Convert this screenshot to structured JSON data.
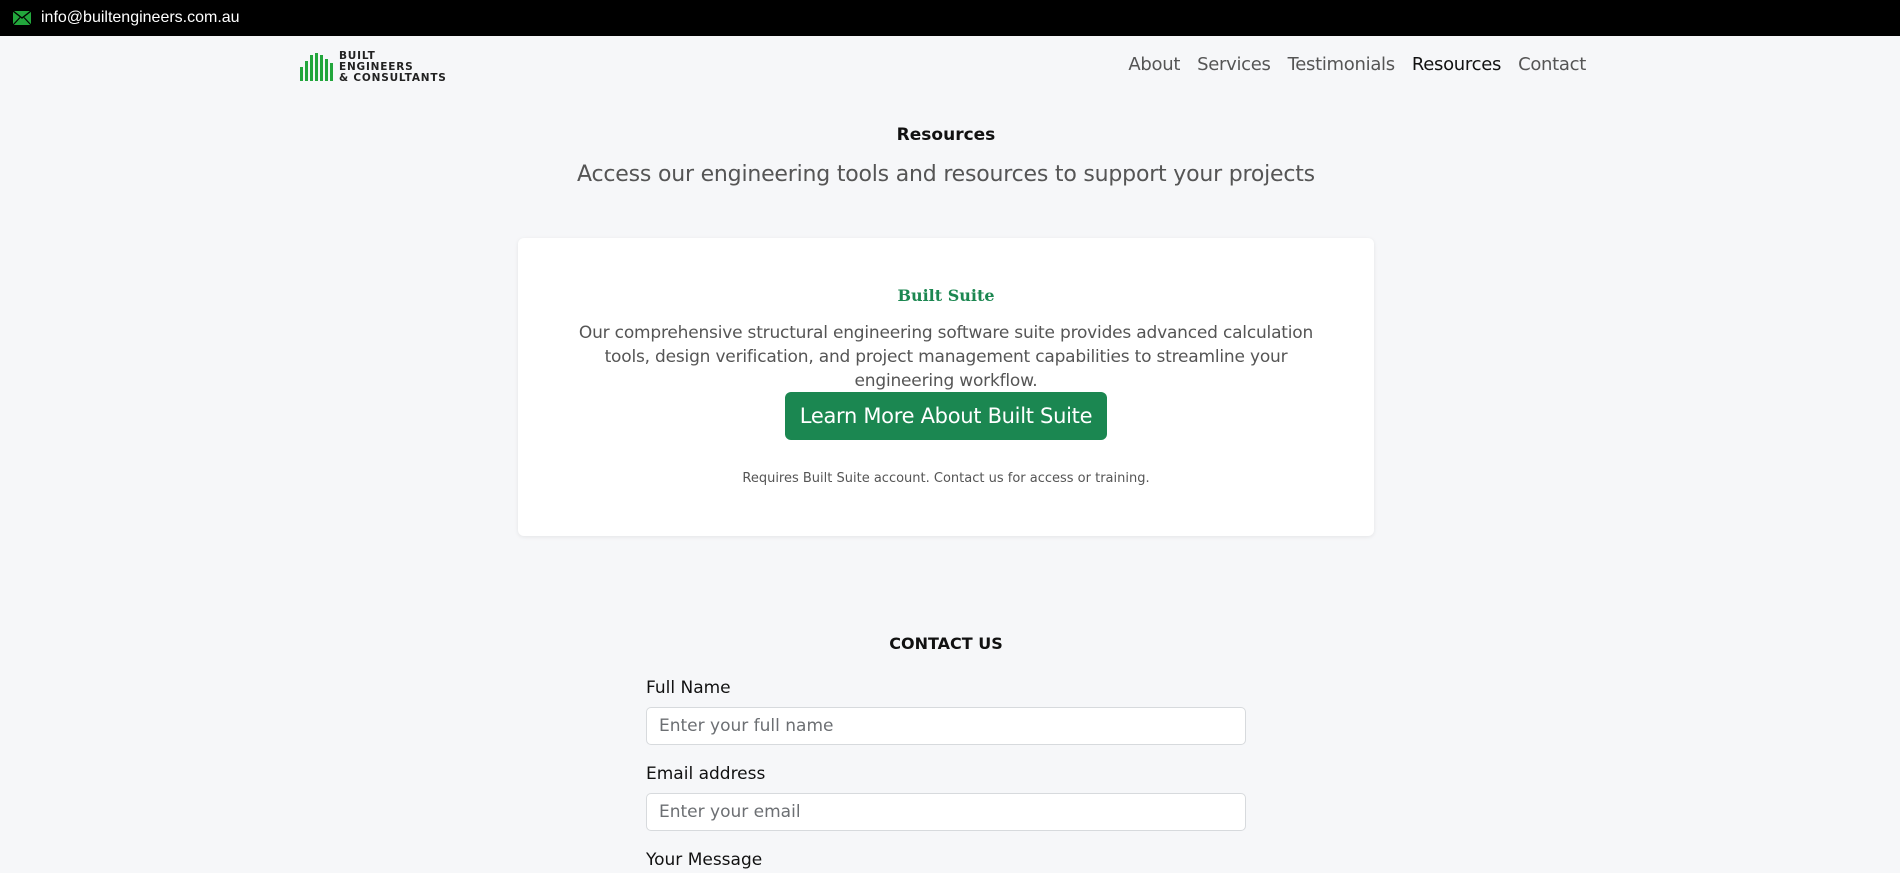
{
  "topbar": {
    "email": "info@builtengineers.com.au",
    "mail_icon": "envelope-icon"
  },
  "brand": {
    "line1": "BUILT",
    "line2": "ENGINEERS",
    "line3": "& CONSULTANTS",
    "accent_color": "#22a63c"
  },
  "nav": {
    "items": [
      "About",
      "Services",
      "Testimonials",
      "Resources",
      "Contact"
    ],
    "active": "Resources"
  },
  "resources": {
    "title": "Resources",
    "subtitle": "Access our engineering tools and resources to support your projects"
  },
  "card": {
    "title": "Built Suite",
    "description": "Our comprehensive structural engineering software suite provides advanced calculation tools, design verification, and project management capabilities to streamline your engineering workflow.",
    "button_label": "Learn More About Built Suite",
    "note": "Requires Built Suite account. Contact us for access or training.",
    "button_color": "#1b8751"
  },
  "contact": {
    "title": "CONTACT US",
    "full_name_label": "Full Name",
    "full_name_placeholder": "Enter your full name",
    "email_label": "Email address",
    "email_placeholder": "Enter your email",
    "message_label": "Your Message"
  }
}
